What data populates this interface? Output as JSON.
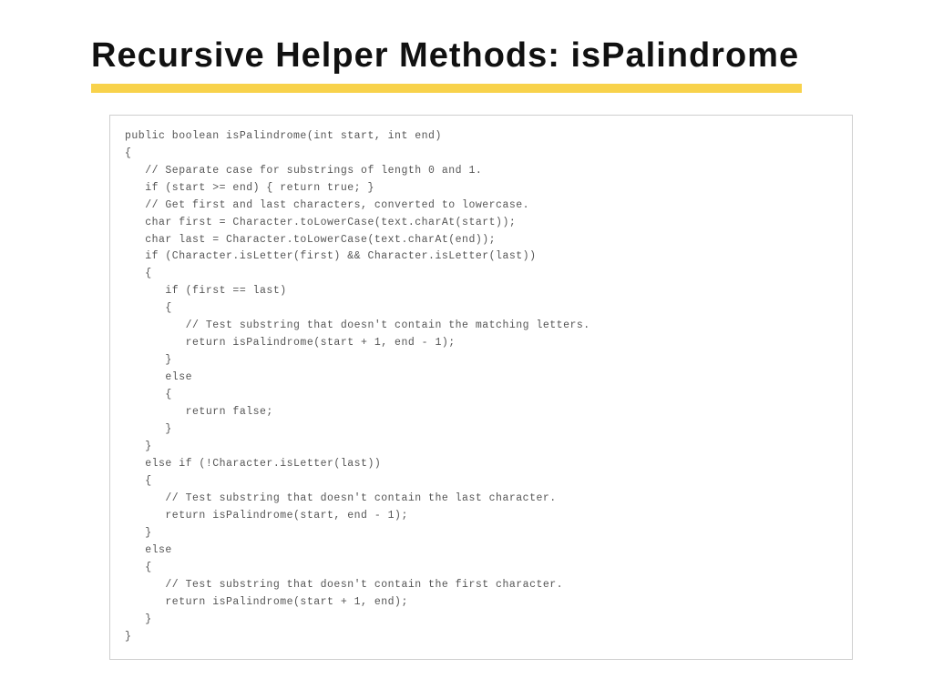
{
  "title": "Recursive Helper Methods: isPalindrome",
  "code": "public boolean isPalindrome(int start, int end)\n{\n   // Separate case for substrings of length 0 and 1.\n   if (start >= end) { return true; }\n   // Get first and last characters, converted to lowercase.\n   char first = Character.toLowerCase(text.charAt(start));\n   char last = Character.toLowerCase(text.charAt(end));\n   if (Character.isLetter(first) && Character.isLetter(last))\n   {\n      if (first == last)\n      {\n         // Test substring that doesn't contain the matching letters.\n         return isPalindrome(start + 1, end - 1);\n      }\n      else\n      {\n         return false;\n      }\n   }\n   else if (!Character.isLetter(last))\n   {\n      // Test substring that doesn't contain the last character.\n      return isPalindrome(start, end - 1);\n   }\n   else\n   {\n      // Test substring that doesn't contain the first character.\n      return isPalindrome(start + 1, end);\n   }\n}"
}
